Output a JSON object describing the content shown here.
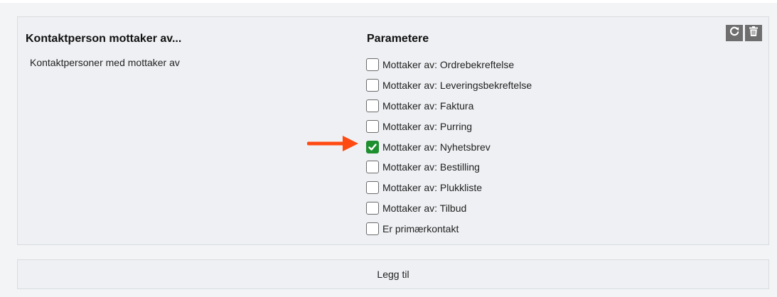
{
  "card": {
    "title": "Kontaktperson mottaker av...",
    "description": "Kontaktpersoner med mottaker av",
    "params_title": "Parametere",
    "actions": {
      "refresh_icon": "refresh-icon",
      "delete_icon": "trash-icon"
    },
    "parameters": [
      {
        "label": "Mottaker av: Ordrebekreftelse",
        "checked": false
      },
      {
        "label": "Mottaker av: Leveringsbekreftelse",
        "checked": false
      },
      {
        "label": "Mottaker av: Faktura",
        "checked": false
      },
      {
        "label": "Mottaker av: Purring",
        "checked": false
      },
      {
        "label": "Mottaker av: Nyhetsbrev",
        "checked": true
      },
      {
        "label": "Mottaker av: Bestilling",
        "checked": false
      },
      {
        "label": "Mottaker av: Plukkliste",
        "checked": false
      },
      {
        "label": "Mottaker av: Tilbud",
        "checked": false
      },
      {
        "label": "Er primærkontakt",
        "checked": false
      }
    ]
  },
  "add_button": {
    "label": "Legg til"
  },
  "colors": {
    "checked": "#1e8f2e",
    "annotation_arrow": "#ff4a12",
    "action_button": "#6e6e6e"
  }
}
